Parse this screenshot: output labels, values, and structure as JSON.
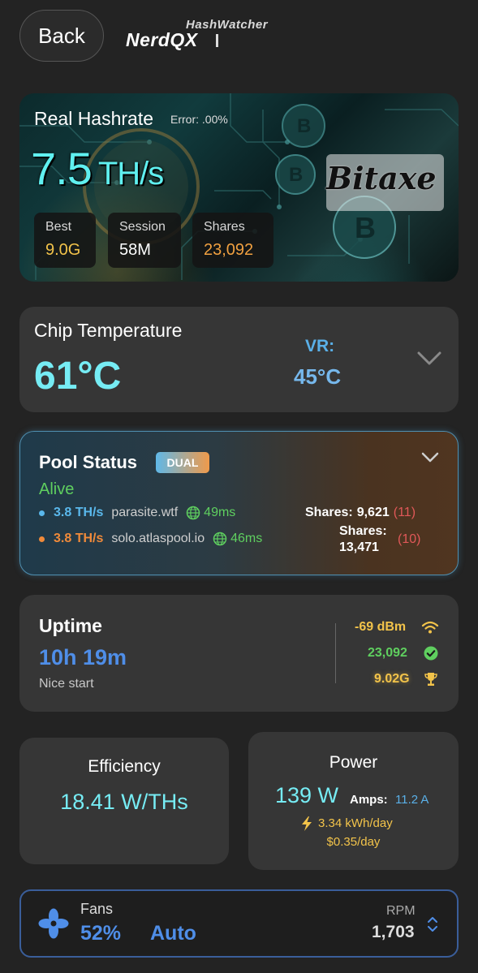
{
  "header": {
    "back_label": "Back",
    "brand_top": "HashWatcher",
    "brand_main": "NerdQX"
  },
  "hashrate": {
    "title": "Real Hashrate",
    "error_label": "Error: .00%",
    "value": "7.5",
    "unit": "TH/s",
    "device_logo": "Bitaxe",
    "stats": [
      {
        "label": "Best",
        "value": "9.0G",
        "color": "#f2c34a"
      },
      {
        "label": "Session",
        "value": "58M",
        "color": "#ffffff"
      },
      {
        "label": "Shares",
        "value": "23,092",
        "color": "#f0a040"
      }
    ]
  },
  "chip": {
    "title": "Chip Temperature",
    "value": "61°C",
    "vr_label": "VR:",
    "vr_value": "45°C"
  },
  "pool": {
    "title": "Pool Status",
    "badge": "DUAL",
    "status": "Alive",
    "pools": [
      {
        "hashrate": "3.8 TH/s",
        "host": "parasite.wtf",
        "ping": "49ms",
        "shares_label": "Shares:",
        "shares": "9,621",
        "rejected": "(11)",
        "color": "#5ab8ec"
      },
      {
        "hashrate": "3.8 TH/s",
        "host": "solo.atlaspool.io",
        "ping": "46ms",
        "shares_label": "Shares:",
        "shares": "13,471",
        "rejected": "(10)",
        "color": "#f08a3a"
      }
    ]
  },
  "uptime": {
    "title": "Uptime",
    "value": "10h 19m",
    "note": "Nice start",
    "wifi": "-69 dBm",
    "accepted": "23,092",
    "best": "9.02G"
  },
  "efficiency": {
    "title": "Efficiency",
    "value": "18.41 W/THs"
  },
  "power": {
    "title": "Power",
    "watts": "139 W",
    "amps_label": "Amps:",
    "amps": "11.2 A",
    "kwh": "3.34 kWh/day",
    "cost": "$0.35/day"
  },
  "fans": {
    "label": "Fans",
    "percent": "52%",
    "mode": "Auto",
    "rpm_label": "RPM",
    "rpm": "1,703"
  }
}
